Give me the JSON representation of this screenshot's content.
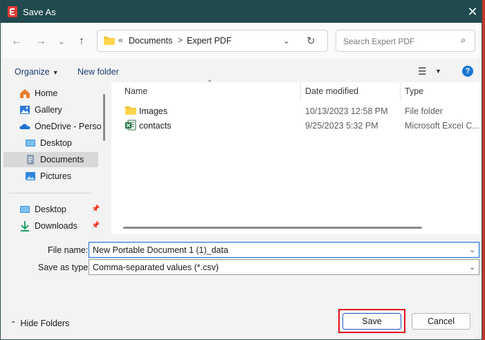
{
  "window": {
    "title": "Save As",
    "close_glyph": "✕"
  },
  "nav": {
    "back_glyph": "←",
    "forward_glyph": "→",
    "recent_glyph": "⌄",
    "up_glyph": "↑",
    "address": {
      "overflow": "«",
      "crumbs": [
        "Documents",
        "Expert PDF"
      ],
      "separator": ">",
      "dropdown_glyph": "⌄",
      "refresh_glyph": "↻"
    },
    "search_placeholder": "Search Expert PDF",
    "search_glyph": "⌕"
  },
  "toolbar": {
    "organize": "Organize",
    "new_folder": "New folder",
    "help": "?"
  },
  "sidebar": {
    "items": [
      {
        "label": "Home",
        "icon": "home-icon"
      },
      {
        "label": "Gallery",
        "icon": "gallery-icon"
      },
      {
        "label": "OneDrive - Perso",
        "icon": "onedrive-icon"
      },
      {
        "label": "Desktop",
        "icon": "desktop-icon"
      },
      {
        "label": "Documents",
        "icon": "documents-icon",
        "selected": true
      },
      {
        "label": "Pictures",
        "icon": "pictures-icon"
      },
      {
        "label": "Desktop",
        "icon": "desktop-icon",
        "pinned": true
      },
      {
        "label": "Downloads",
        "icon": "downloads-icon",
        "pinned": true
      }
    ]
  },
  "files": {
    "columns": [
      "Name",
      "Date modified",
      "Type"
    ],
    "rows": [
      {
        "name": "Images",
        "date": "10/13/2023 12:58 PM",
        "type": "File folder",
        "icon": "folder-icon"
      },
      {
        "name": "contacts",
        "date": "9/25/2023 5:32 PM",
        "type": "Microsoft Excel C...",
        "icon": "excel-icon"
      }
    ]
  },
  "form": {
    "file_name_label": "File name:",
    "file_name_value": "New Portable Document 1 (1)_data",
    "save_type_label": "Save as type:",
    "save_type_value": "Comma-separated values (*.csv)"
  },
  "footer": {
    "hide_folders": "Hide Folders",
    "save": "Save",
    "cancel": "Cancel"
  },
  "colors": {
    "titlebar": "#204a4e",
    "accent": "#1976d2",
    "highlight": "#e0101a"
  }
}
